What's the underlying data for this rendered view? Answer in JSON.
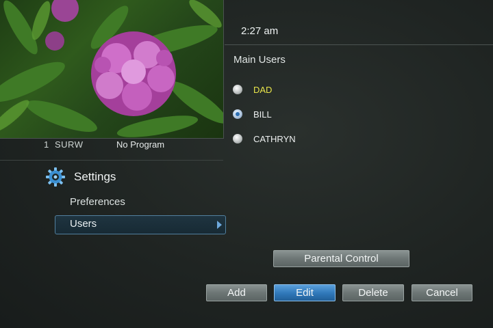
{
  "preview": {
    "channel_number": "1",
    "channel_name": "SURW",
    "program": "No Program"
  },
  "clock": "2:27 am",
  "users_panel": {
    "title": "Main Users",
    "users": [
      {
        "label": "DAD",
        "selected": false,
        "highlighted": true
      },
      {
        "label": "BILL",
        "selected": true,
        "highlighted": false
      },
      {
        "label": "CATHRYN",
        "selected": false,
        "highlighted": false
      }
    ]
  },
  "settings": {
    "title": "Settings",
    "icon": "gear-icon",
    "items": [
      {
        "label": "Preferences"
      },
      {
        "label": "Users",
        "active": true
      }
    ]
  },
  "buttons": {
    "parental_control": "Parental Control",
    "add": "Add",
    "edit": "Edit",
    "delete": "Delete",
    "cancel": "Cancel"
  },
  "colors": {
    "accent": "#2f77b8",
    "highlight_text": "#e9e64a"
  }
}
